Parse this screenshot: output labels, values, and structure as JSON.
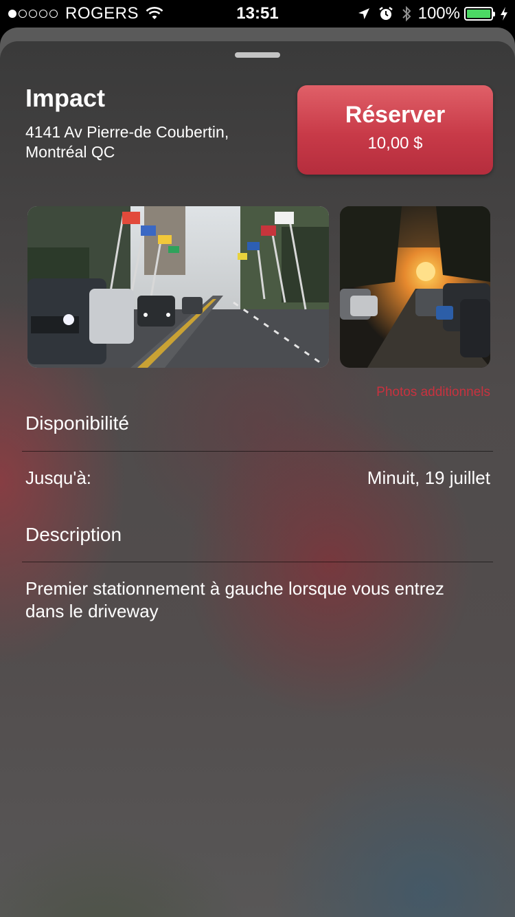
{
  "status_bar": {
    "carrier": "ROGERS",
    "time": "13:51",
    "battery": "100%"
  },
  "listing": {
    "title": "Impact",
    "address": "4141 Av Pierre-de Coubertin, Montréal QC"
  },
  "reserve": {
    "label": "Réserver",
    "price": "10,00 $"
  },
  "photos": {
    "more_link": "Photos additionnels"
  },
  "availability": {
    "heading": "Disponibilité",
    "until_label": "Jusqu'à:",
    "until_value": "Minuit, 19 juillet"
  },
  "description": {
    "heading": "Description",
    "text": "Premier stationnement à gauche lorsque vous entrez dans le driveway"
  },
  "colors": {
    "accent": "#c8323f",
    "battery": "#4cd964"
  }
}
